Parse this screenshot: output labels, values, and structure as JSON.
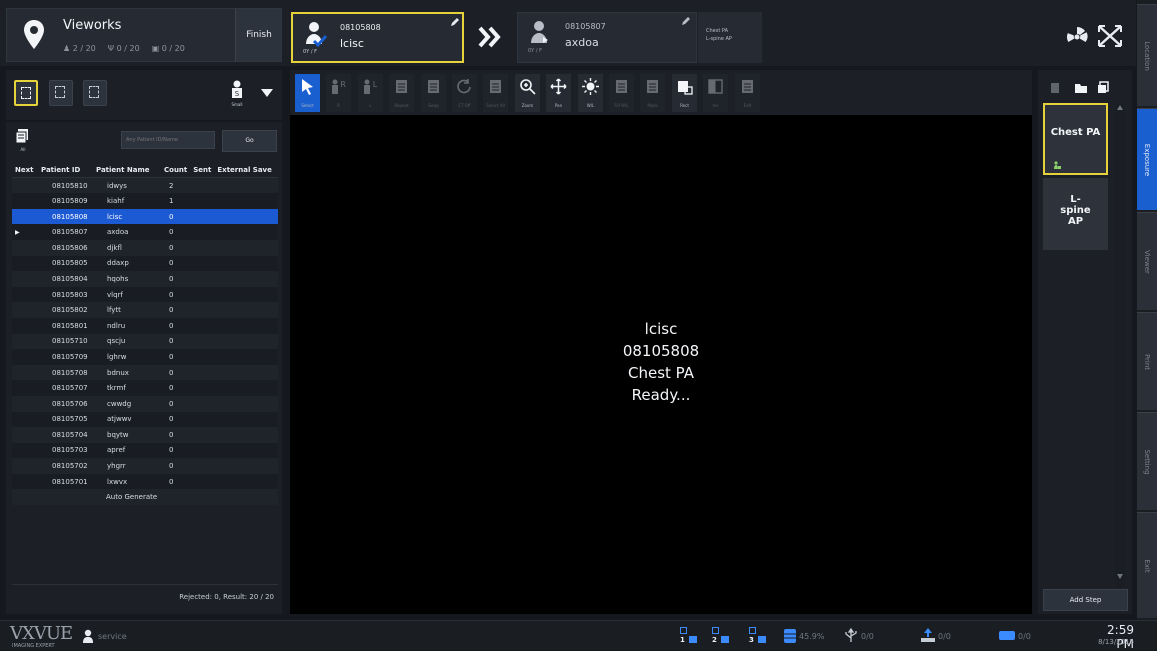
{
  "header": {
    "location": {
      "title": "Vieworks",
      "patients": "2 / 20",
      "usb": "0 / 20",
      "network": "0 / 20",
      "finish_label": "Finish"
    },
    "current_patient": {
      "id": "08105808",
      "name": "lcisc",
      "badge": "0Y / F"
    },
    "next_patient": {
      "id": "08105807",
      "name": "axdoa",
      "badge": "0Y / F",
      "steps": [
        "Chest PA",
        "L-spine AP"
      ]
    }
  },
  "left_toolbar": {
    "size_label": "Small"
  },
  "search": {
    "filter_label": "All",
    "placeholder": "Any Patient ID/Name",
    "go_label": "Go"
  },
  "table": {
    "columns": [
      "Next",
      "Patient ID",
      "Patient Name",
      "Count",
      "Sent",
      "External Save"
    ],
    "rows": [
      {
        "id": "08105810",
        "name": "idwys",
        "count": "2"
      },
      {
        "id": "08105809",
        "name": "kiahf",
        "count": "1"
      },
      {
        "id": "08105808",
        "name": "lcisc",
        "count": "0"
      },
      {
        "id": "08105807",
        "name": "axdoa",
        "count": "0"
      },
      {
        "id": "08105806",
        "name": "djkfl",
        "count": "0"
      },
      {
        "id": "08105805",
        "name": "ddaxp",
        "count": "0"
      },
      {
        "id": "08105804",
        "name": "hqohs",
        "count": "0"
      },
      {
        "id": "08105803",
        "name": "vlqrf",
        "count": "0"
      },
      {
        "id": "08105802",
        "name": "lfytt",
        "count": "0"
      },
      {
        "id": "08105801",
        "name": "ndlru",
        "count": "0"
      },
      {
        "id": "08105710",
        "name": "qscju",
        "count": "0"
      },
      {
        "id": "08105709",
        "name": "lghrw",
        "count": "0"
      },
      {
        "id": "08105708",
        "name": "bdnux",
        "count": "0"
      },
      {
        "id": "08105707",
        "name": "tkrmf",
        "count": "0"
      },
      {
        "id": "08105706",
        "name": "cwwdg",
        "count": "0"
      },
      {
        "id": "08105705",
        "name": "atjwwv",
        "count": "0"
      },
      {
        "id": "08105704",
        "name": "bqytw",
        "count": "0"
      },
      {
        "id": "08105703",
        "name": "apref",
        "count": "0"
      },
      {
        "id": "08105702",
        "name": "yhgrr",
        "count": "0"
      },
      {
        "id": "08105701",
        "name": "lxwvx",
        "count": "0"
      }
    ],
    "auto_generate": "Auto Generate",
    "status": "Rejected: 0, Result: 20 / 20"
  },
  "toolbar": [
    {
      "label": "Select",
      "icon": "cursor-icon",
      "state": "active"
    },
    {
      "label": "R",
      "icon": "marker-r-icon",
      "state": "dim"
    },
    {
      "label": "L",
      "icon": "marker-l-icon",
      "state": "dim"
    },
    {
      "label": "Repeat",
      "icon": "repeat-icon",
      "state": "dim"
    },
    {
      "label": "Swap",
      "icon": "swap-icon",
      "state": "dim"
    },
    {
      "label": "CT-Off",
      "icon": "rotate-icon",
      "state": "dim"
    },
    {
      "label": "Select All",
      "icon": "select-all-icon",
      "state": "dim"
    },
    {
      "label": "Zoom",
      "icon": "zoom-icon",
      "state": "normal"
    },
    {
      "label": "Pan",
      "icon": "pan-icon",
      "state": "normal"
    },
    {
      "label": "W/L",
      "icon": "window-level-icon",
      "state": "normal"
    },
    {
      "label": "Fill W/L",
      "icon": "fill-wl-icon",
      "state": "dim"
    },
    {
      "label": "Mask",
      "icon": "mask-icon",
      "state": "dim"
    },
    {
      "label": "Rect",
      "icon": "rect-icon",
      "state": "normal"
    },
    {
      "label": "Inv",
      "icon": "invert-icon",
      "state": "dim"
    },
    {
      "label": "Edit",
      "icon": "edit-icon",
      "state": "dim"
    }
  ],
  "viewer": {
    "lines": [
      "lcisc",
      "08105808",
      "Chest PA",
      "Ready..."
    ]
  },
  "steps_panel": {
    "steps": [
      "Chest PA",
      "L-spine AP"
    ],
    "add_step_label": "Add Step"
  },
  "side_nav": [
    "Location",
    "Exposure",
    "Viewer",
    "Print",
    "Setting",
    "Exit"
  ],
  "footer": {
    "brand": "VXVUE",
    "brand_sub": "IMAGING EXPERT",
    "user": "service",
    "slots": [
      "1",
      "2",
      "3"
    ],
    "disk": "45.9%",
    "usb": "0/0",
    "upload": "0/0",
    "network": "0/0",
    "time": "2:59 PM",
    "date": "8/13/2015"
  },
  "colors": {
    "accent": "#1a5fd0",
    "highlight": "#e6d23a"
  }
}
